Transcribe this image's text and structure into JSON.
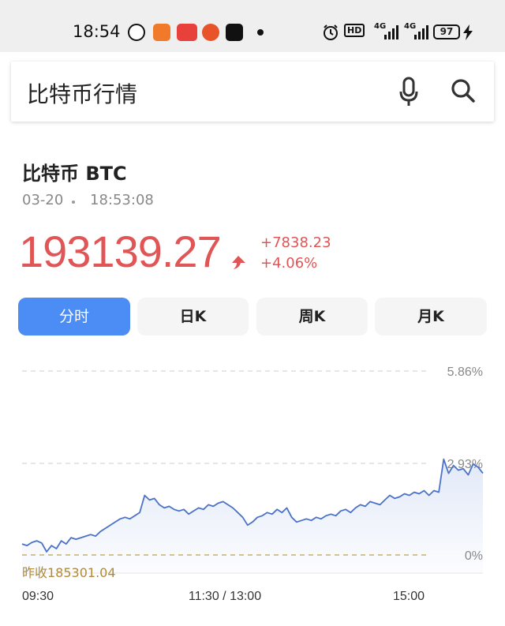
{
  "status_bar": {
    "time": "18:54",
    "battery": "97",
    "net1": "4G",
    "net2": "4G",
    "hd": "HD"
  },
  "search": {
    "query": "比特币行情"
  },
  "quote": {
    "name": "比特币 BTC",
    "date": "03-20",
    "time": "18:53:08",
    "price": "193139.27",
    "change": "+7838.23",
    "change_pct": "+4.06%",
    "up_color": "#e05555"
  },
  "tabs": [
    {
      "label": "分时",
      "active": true
    },
    {
      "label": "日K",
      "active": false
    },
    {
      "label": "周K",
      "active": false
    },
    {
      "label": "月K",
      "active": false
    }
  ],
  "chart_data": {
    "type": "line",
    "y_right_labels": [
      "5.86%",
      "2.93%",
      "0%"
    ],
    "ylim_pct": [
      -0.6,
      5.86
    ],
    "prev_close_label": "昨收185301.04",
    "x_tick_labels": [
      "09:30",
      "11:30 / 13:00",
      "15:00"
    ],
    "line_color": "#4a72c8",
    "series": [
      {
        "values_pct": [
          0.35,
          0.3,
          0.4,
          0.45,
          0.38,
          0.1,
          0.3,
          0.2,
          0.45,
          0.35,
          0.55,
          0.5,
          0.55,
          0.6,
          0.65,
          0.6,
          0.75,
          0.85,
          0.95,
          1.05,
          1.15,
          1.2,
          1.15,
          1.25,
          1.35,
          1.9,
          1.75,
          1.8,
          1.6,
          1.5,
          1.55,
          1.45,
          1.4,
          1.45,
          1.3,
          1.4,
          1.5,
          1.45,
          1.6,
          1.55,
          1.65,
          1.7,
          1.6,
          1.5,
          1.35,
          1.2,
          0.95,
          1.05,
          1.2,
          1.25,
          1.35,
          1.3,
          1.45,
          1.35,
          1.5,
          1.2,
          1.05,
          1.1,
          1.15,
          1.1,
          1.2,
          1.15,
          1.25,
          1.3,
          1.25,
          1.4,
          1.45,
          1.35,
          1.5,
          1.6,
          1.55,
          1.7,
          1.65,
          1.6,
          1.75,
          1.9,
          1.8,
          1.85,
          1.95,
          1.9,
          2.0,
          1.95,
          2.05,
          1.9,
          2.05,
          2.0,
          3.05,
          2.6,
          2.85,
          2.7,
          2.75,
          2.55,
          2.9,
          2.8,
          2.6
        ]
      }
    ]
  }
}
